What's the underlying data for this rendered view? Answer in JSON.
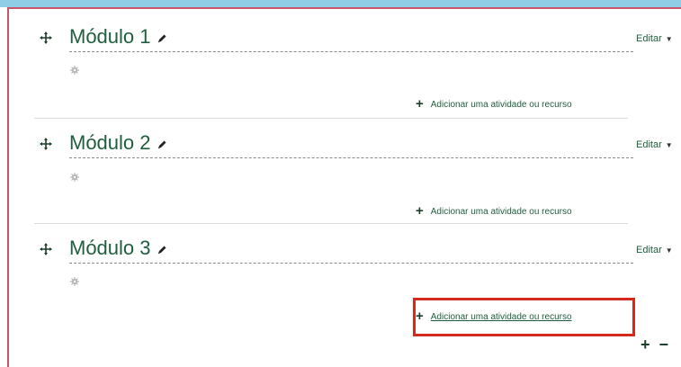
{
  "sections": [
    {
      "title": "Módulo 1",
      "edit_label": "Editar",
      "add_label": "Adicionar uma atividade ou recurso"
    },
    {
      "title": "Módulo 2",
      "edit_label": "Editar",
      "add_label": "Adicionar uma atividade ou recurso"
    },
    {
      "title": "Módulo 3",
      "edit_label": "Editar",
      "add_label": "Adicionar uma atividade ou recurso"
    }
  ],
  "controls": {
    "add_section": "+",
    "remove_section": "−"
  },
  "icons": {
    "move": "move-icon",
    "edit": "pencil-icon",
    "settings": "gear-icon",
    "add": "plus-icon",
    "menu": "caret-down-icon"
  },
  "colors": {
    "title": "#1f5e3e",
    "frame": "#c9536a",
    "highlight": "#d42a1e",
    "top_bar": "#8fcde6"
  }
}
